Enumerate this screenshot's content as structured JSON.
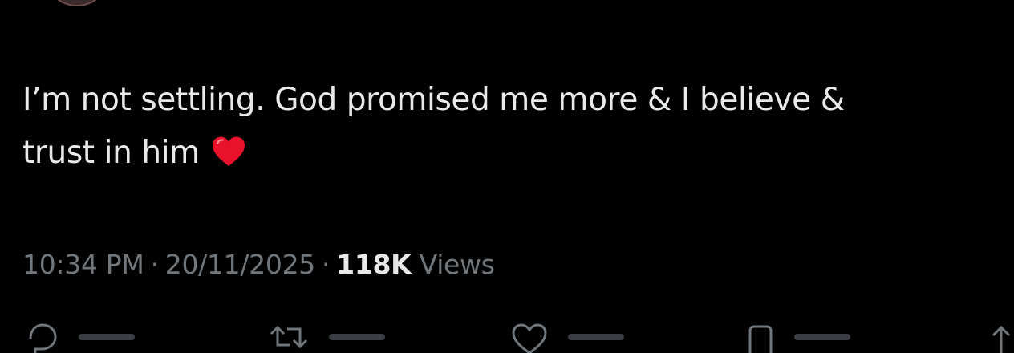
{
  "tweet": {
    "text_line1": "I’m not settling. God promised me more & I believe &",
    "text_line2": "trust in him",
    "emoji": "heart-emoji",
    "time": "10:34 PM",
    "date": "20/11/2025",
    "separator": "·",
    "views_count": "118K",
    "views_label": "Views"
  },
  "icons": {
    "reply": "reply-icon",
    "repost": "repost-icon",
    "like": "like-icon",
    "bookmark": "bookmark-icon",
    "share": "share-icon"
  },
  "colors": {
    "background": "#000000",
    "text": "#e7e9ea",
    "muted": "#71767b",
    "heart": "#e8132a"
  }
}
